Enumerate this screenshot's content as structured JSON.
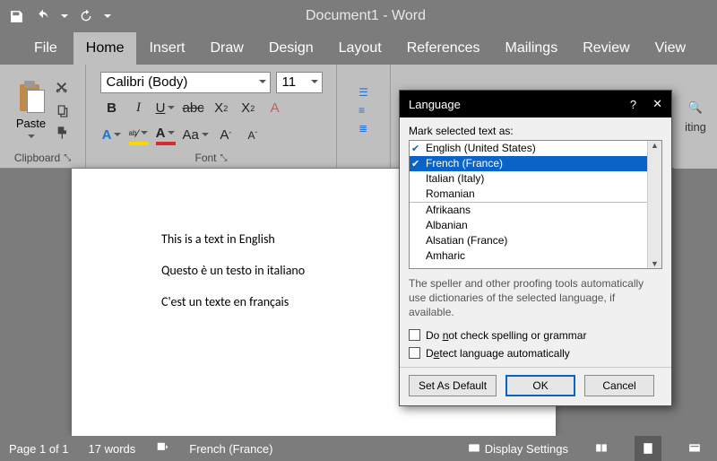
{
  "title": "Document1  -  Word",
  "tabs": [
    "File",
    "Home",
    "Insert",
    "Draw",
    "Design",
    "Layout",
    "References",
    "Mailings",
    "Review",
    "View"
  ],
  "activeTab": "Home",
  "ribbon": {
    "clipboard": {
      "paste": "Paste",
      "label": "Clipboard"
    },
    "font": {
      "name": "Calibri (Body)",
      "size": "11",
      "label": "Font"
    }
  },
  "document": {
    "lines": [
      "This is a text in English",
      "Questo è un testo in italiano",
      "C'est un texte en français"
    ]
  },
  "status": {
    "page": "Page 1 of 1",
    "words": "17 words",
    "language": "French (France)",
    "display": "Display Settings"
  },
  "dialog": {
    "title": "Language",
    "markLabel": "Mark selected text as:",
    "languages": [
      {
        "name": "English (United States)",
        "checked": true,
        "selected": false
      },
      {
        "name": "French (France)",
        "checked": true,
        "selected": true
      },
      {
        "name": "Italian (Italy)",
        "checked": false,
        "selected": false
      },
      {
        "name": "Romanian",
        "checked": false,
        "selected": false
      },
      {
        "name": "Afrikaans",
        "checked": false,
        "selected": false,
        "sep": true
      },
      {
        "name": "Albanian",
        "checked": false,
        "selected": false
      },
      {
        "name": "Alsatian (France)",
        "checked": false,
        "selected": false
      },
      {
        "name": "Amharic",
        "checked": false,
        "selected": false
      }
    ],
    "note": "The speller and other proofing tools automatically use dictionaries of the selected language, if available.",
    "check1_pre": "Do ",
    "check1_u": "n",
    "check1_post": "ot check spelling or grammar",
    "check2_pre": "D",
    "check2_u": "e",
    "check2_post": "tect language automatically",
    "btnDefault": "Set As Default",
    "btnOk": "OK",
    "btnCancel": "Cancel"
  },
  "editingPeek": "iting"
}
